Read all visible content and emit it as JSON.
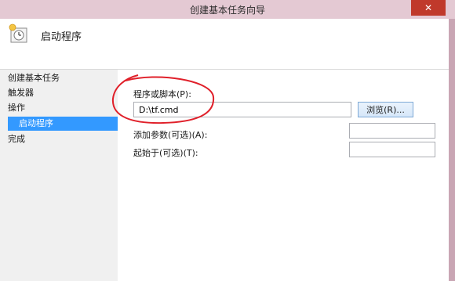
{
  "window": {
    "title": "创建基本任务向导",
    "close_glyph": "✕"
  },
  "header": {
    "title": "启动程序",
    "icon": "clock-task-icon"
  },
  "nav": {
    "items": [
      {
        "label": "创建基本任务"
      },
      {
        "label": "触发器"
      },
      {
        "label": "操作"
      },
      {
        "label": "启动程序",
        "active": true
      },
      {
        "label": "完成"
      }
    ]
  },
  "form": {
    "program_label": "程序或脚本(P):",
    "program_value": "D:\\tf.cmd",
    "browse_label": "浏览(R)...",
    "args_label": "添加参数(可选)(A):",
    "args_value": "",
    "startin_label": "起始于(可选)(T):",
    "startin_value": ""
  },
  "colors": {
    "selection": "#3399ff",
    "annotation": "#e0202a",
    "titlebar": "#e4c9d3"
  }
}
